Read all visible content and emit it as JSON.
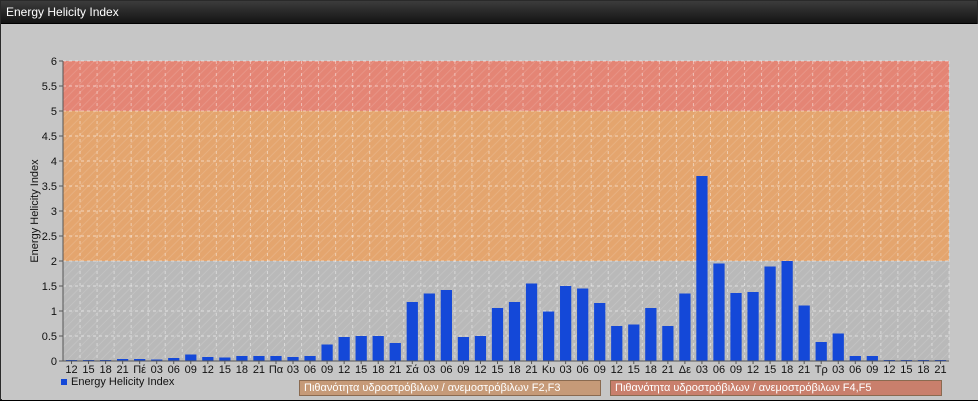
{
  "window": {
    "title": "Energy Helicity Index"
  },
  "zones": {
    "f23_label": "Πιθανότητα υδροστρόβιλων / ανεμοστρόβιλων F2,F3",
    "f45_label": "Πιθανότητα υδροστρόβιλων / ανεμοστρόβιλων F4,F5"
  },
  "colors": {
    "bar": "#1448d8",
    "zone_low": "#b9b9b9",
    "zone_mid": "#e4a56e",
    "zone_high": "#e48575"
  },
  "chart_data": {
    "type": "bar",
    "title": "",
    "xlabel": "",
    "ylabel": "Energy Helicity Index",
    "ylim": [
      0,
      6
    ],
    "yticks": [
      0,
      0.5,
      1,
      1.5,
      2,
      2.5,
      3,
      3.5,
      4,
      4.5,
      5,
      5.5,
      6
    ],
    "grid": true,
    "legend": {
      "position": "bottom-left",
      "entries": [
        "Energy Helicity Index"
      ]
    },
    "bands": [
      {
        "from": 0,
        "to": 2,
        "color": "#b9b9b9"
      },
      {
        "from": 2,
        "to": 5,
        "color": "#e4a56e"
      },
      {
        "from": 5,
        "to": 6,
        "color": "#e48575"
      }
    ],
    "categories": [
      "12",
      "15",
      "18",
      "21",
      "Πέ",
      "03",
      "06",
      "09",
      "12",
      "15",
      "18",
      "21",
      "Πα",
      "03",
      "06",
      "09",
      "12",
      "15",
      "18",
      "21",
      "Σά",
      "03",
      "06",
      "09",
      "12",
      "15",
      "18",
      "21",
      "Κυ",
      "03",
      "06",
      "09",
      "12",
      "15",
      "18",
      "21",
      "Δε",
      "03",
      "06",
      "09",
      "12",
      "15",
      "18",
      "21",
      "Τρ",
      "03",
      "06",
      "09",
      "12",
      "15",
      "18",
      "21"
    ],
    "series": [
      {
        "name": "Energy Helicity Index",
        "values": [
          0.02,
          0.02,
          0.02,
          0.04,
          0.04,
          0.03,
          0.06,
          0.13,
          0.08,
          0.07,
          0.1,
          0.1,
          0.1,
          0.08,
          0.1,
          0.33,
          0.48,
          0.5,
          0.5,
          0.36,
          1.18,
          1.35,
          1.42,
          0.48,
          0.5,
          1.06,
          1.18,
          1.55,
          0.99,
          1.5,
          1.45,
          1.16,
          0.7,
          0.73,
          1.06,
          0.7,
          1.35,
          3.7,
          1.95,
          1.36,
          1.38,
          1.89,
          2.0,
          1.11,
          0.38,
          0.55,
          0.1,
          0.1,
          0.02,
          0.02,
          0.02,
          0.02
        ]
      }
    ]
  }
}
